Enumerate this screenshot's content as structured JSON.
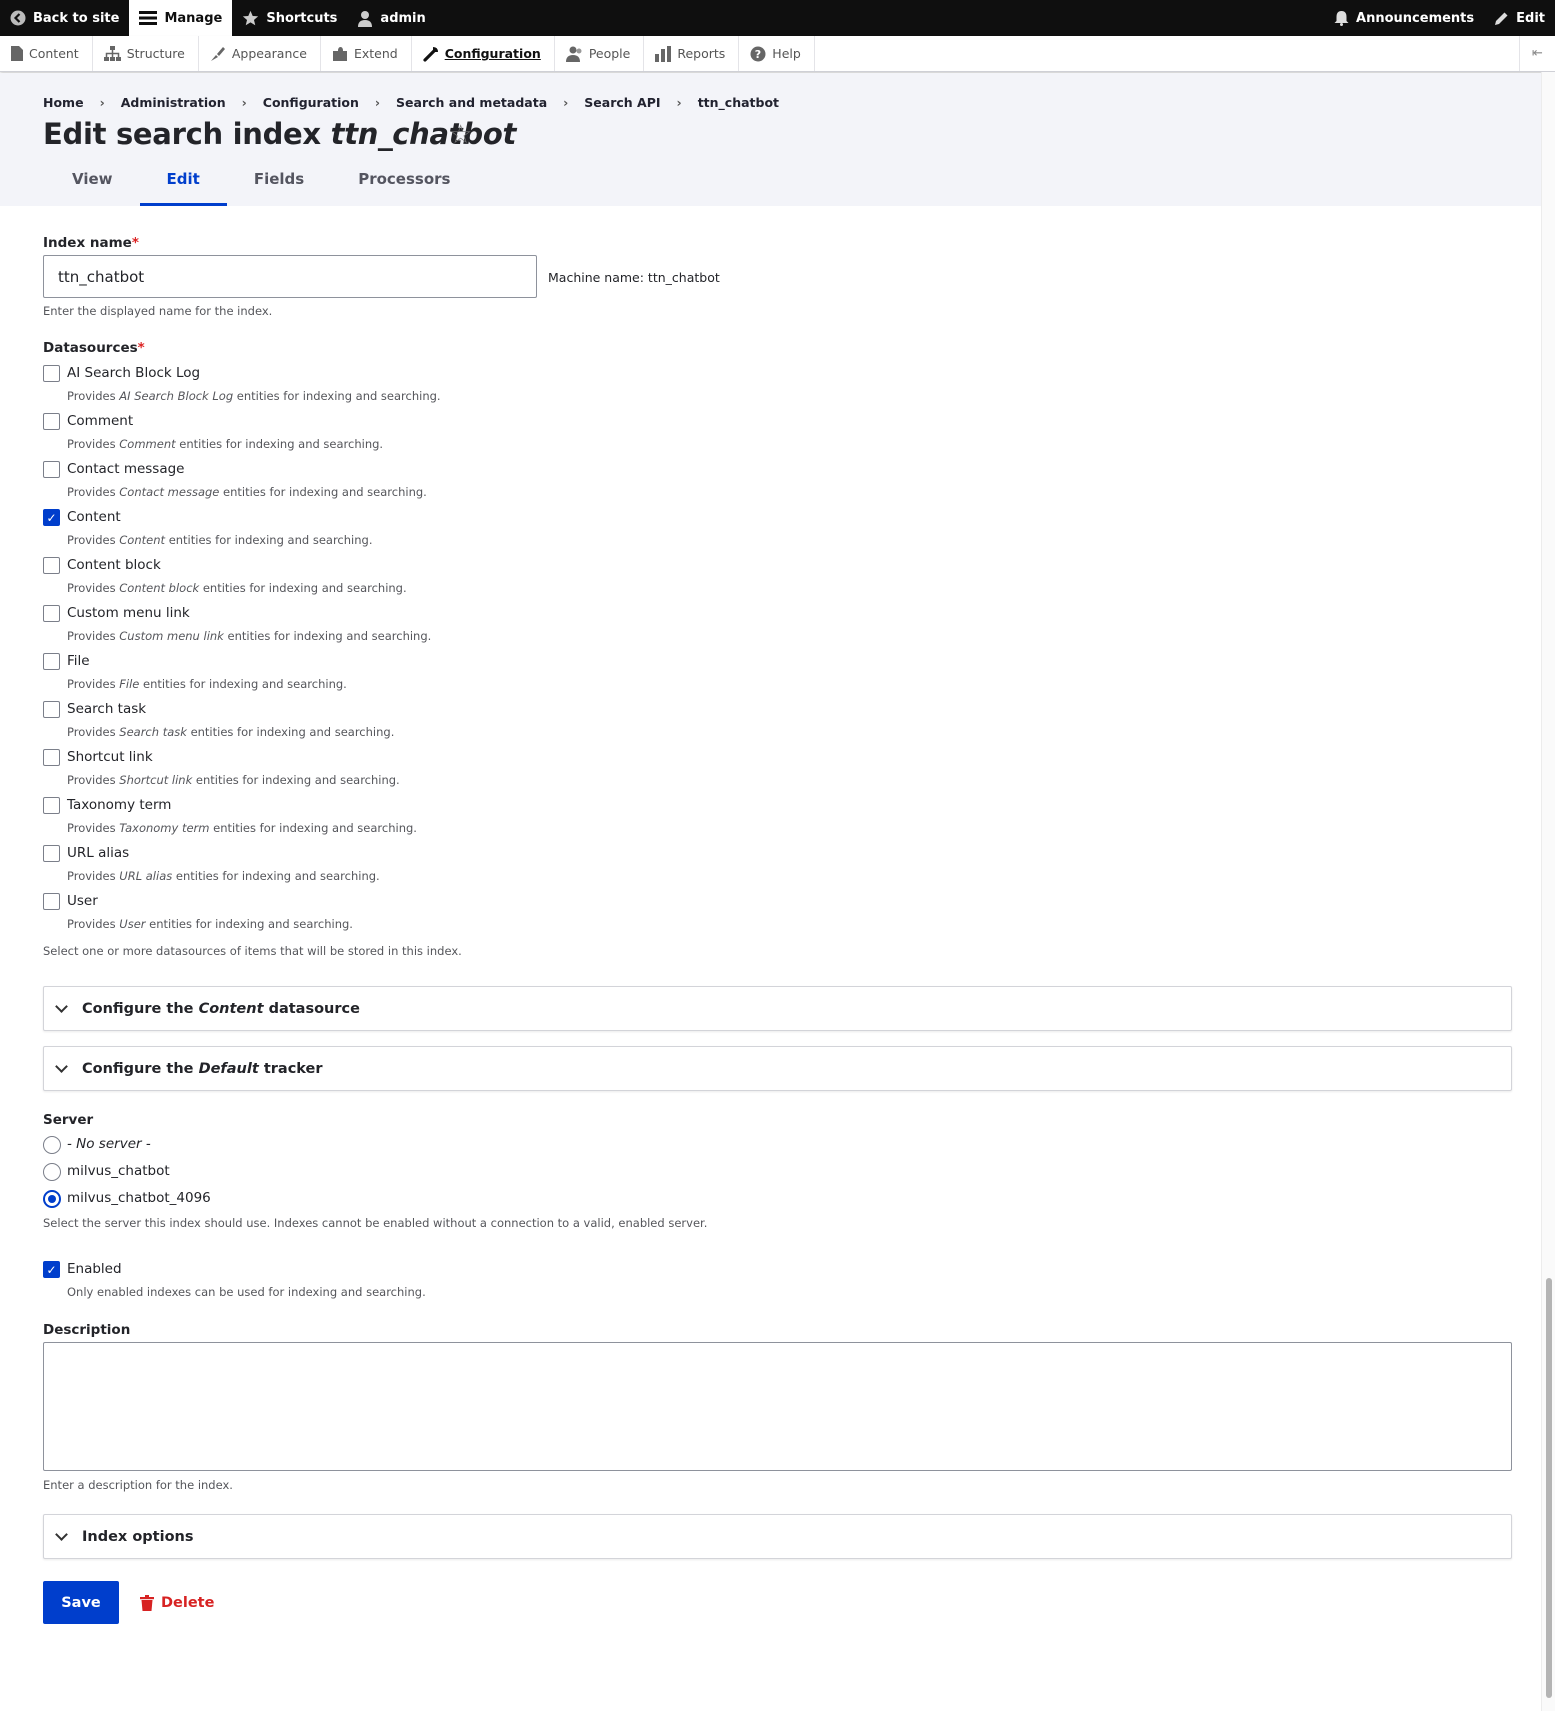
{
  "toolbar": {
    "back_to_site": "Back to site",
    "manage": "Manage",
    "shortcuts": "Shortcuts",
    "user": "admin",
    "announcements": "Announcements",
    "edit": "Edit"
  },
  "tray": {
    "items": [
      "Content",
      "Structure",
      "Appearance",
      "Extend",
      "Configuration",
      "People",
      "Reports",
      "Help"
    ],
    "active": "Configuration"
  },
  "breadcrumb": [
    "Home",
    "Administration",
    "Configuration",
    "Search and metadata",
    "Search API",
    "ttn_chatbot"
  ],
  "page_title": {
    "prefix": "Edit search index",
    "name": "ttn_chatbot"
  },
  "tabs": [
    "View",
    "Edit",
    "Fields",
    "Processors"
  ],
  "active_tab": "Edit",
  "index_name": {
    "label": "Index name",
    "value": "ttn_chatbot",
    "machine_name": "Machine name: ttn_chatbot",
    "help": "Enter the displayed name for the index."
  },
  "datasources": {
    "label": "Datasources",
    "desc_prefix": "Provides",
    "desc_suffix": "entities for indexing and searching.",
    "items": [
      {
        "label": "AI Search Block Log",
        "checked": false
      },
      {
        "label": "Comment",
        "checked": false
      },
      {
        "label": "Contact message",
        "checked": false
      },
      {
        "label": "Content",
        "checked": true
      },
      {
        "label": "Content block",
        "checked": false
      },
      {
        "label": "Custom menu link",
        "checked": false
      },
      {
        "label": "File",
        "checked": false
      },
      {
        "label": "Search task",
        "checked": false
      },
      {
        "label": "Shortcut link",
        "checked": false
      },
      {
        "label": "Taxonomy term",
        "checked": false
      },
      {
        "label": "URL alias",
        "checked": false
      },
      {
        "label": "User",
        "checked": false
      }
    ],
    "help": "Select one or more datasources of items that will be stored in this index."
  },
  "details": {
    "content_datasource": {
      "prefix": "Configure the",
      "em": "Content",
      "suffix": "datasource"
    },
    "default_tracker": {
      "prefix": "Configure the",
      "em": "Default",
      "suffix": "tracker"
    },
    "index_options": "Index options"
  },
  "server": {
    "label": "Server",
    "options": [
      {
        "label": "- No server -",
        "selected": false,
        "italic": true
      },
      {
        "label": "milvus_chatbot",
        "selected": false,
        "italic": false
      },
      {
        "label": "milvus_chatbot_4096",
        "selected": true,
        "italic": false
      }
    ],
    "help": "Select the server this index should use. Indexes cannot be enabled without a connection to a valid, enabled server."
  },
  "enabled": {
    "label": "Enabled",
    "checked": true,
    "help": "Only enabled indexes can be used for indexing and searching."
  },
  "description": {
    "label": "Description",
    "value": "",
    "help": "Enter a description for the index."
  },
  "actions": {
    "save": "Save",
    "delete": "Delete"
  },
  "colors": {
    "accent": "#003ecc",
    "danger": "#d72222",
    "toolbar": "#0f0f0f",
    "header_bg": "#f3f4f9"
  }
}
